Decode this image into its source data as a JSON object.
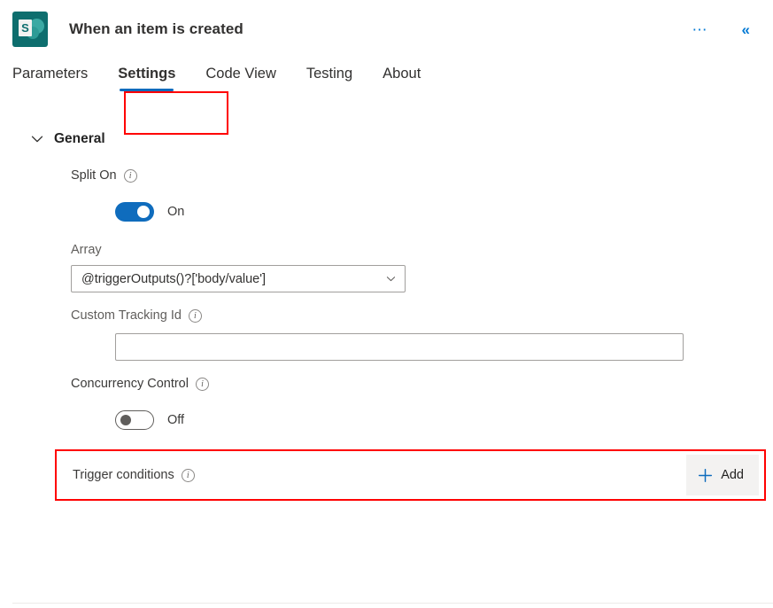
{
  "header": {
    "app_icon": "sharepoint-icon",
    "app_icon_letter": "S",
    "title": "When an item is created",
    "more_icon": "ellipsis-icon",
    "collapse_icon": "double-chevron-left-icon"
  },
  "tabs": [
    {
      "label": "Parameters",
      "active": false
    },
    {
      "label": "Settings",
      "active": true
    },
    {
      "label": "Code View",
      "active": false
    },
    {
      "label": "Testing",
      "active": false
    },
    {
      "label": "About",
      "active": false
    }
  ],
  "section": {
    "title": "General",
    "expanded": true,
    "chevron_icon": "chevron-down-icon"
  },
  "fields": {
    "split_on": {
      "label": "Split On",
      "info_icon": "info-icon",
      "toggle_state": "On",
      "toggle_label": "On"
    },
    "array": {
      "label": "Array",
      "value": "@triggerOutputs()?['body/value']",
      "chevron_icon": "chevron-down-icon"
    },
    "custom_tracking_id": {
      "label": "Custom Tracking Id",
      "info_icon": "info-icon",
      "value": "",
      "placeholder": ""
    },
    "concurrency_control": {
      "label": "Concurrency Control",
      "info_icon": "info-icon",
      "toggle_state": "Off",
      "toggle_label": "Off"
    },
    "trigger_conditions": {
      "label": "Trigger conditions",
      "info_icon": "info-icon",
      "add_label": "Add",
      "add_icon": "plus-icon"
    }
  },
  "annotations": {
    "settings_tab_highlight": "#ff0000",
    "trigger_conditions_highlight": "#ff0000"
  },
  "colors": {
    "accent": "#0f6cbd",
    "link": "#0078d4",
    "sharepoint_teal": "#0e6e6e",
    "button_bg": "#f3f2f1",
    "text": "#323130"
  }
}
